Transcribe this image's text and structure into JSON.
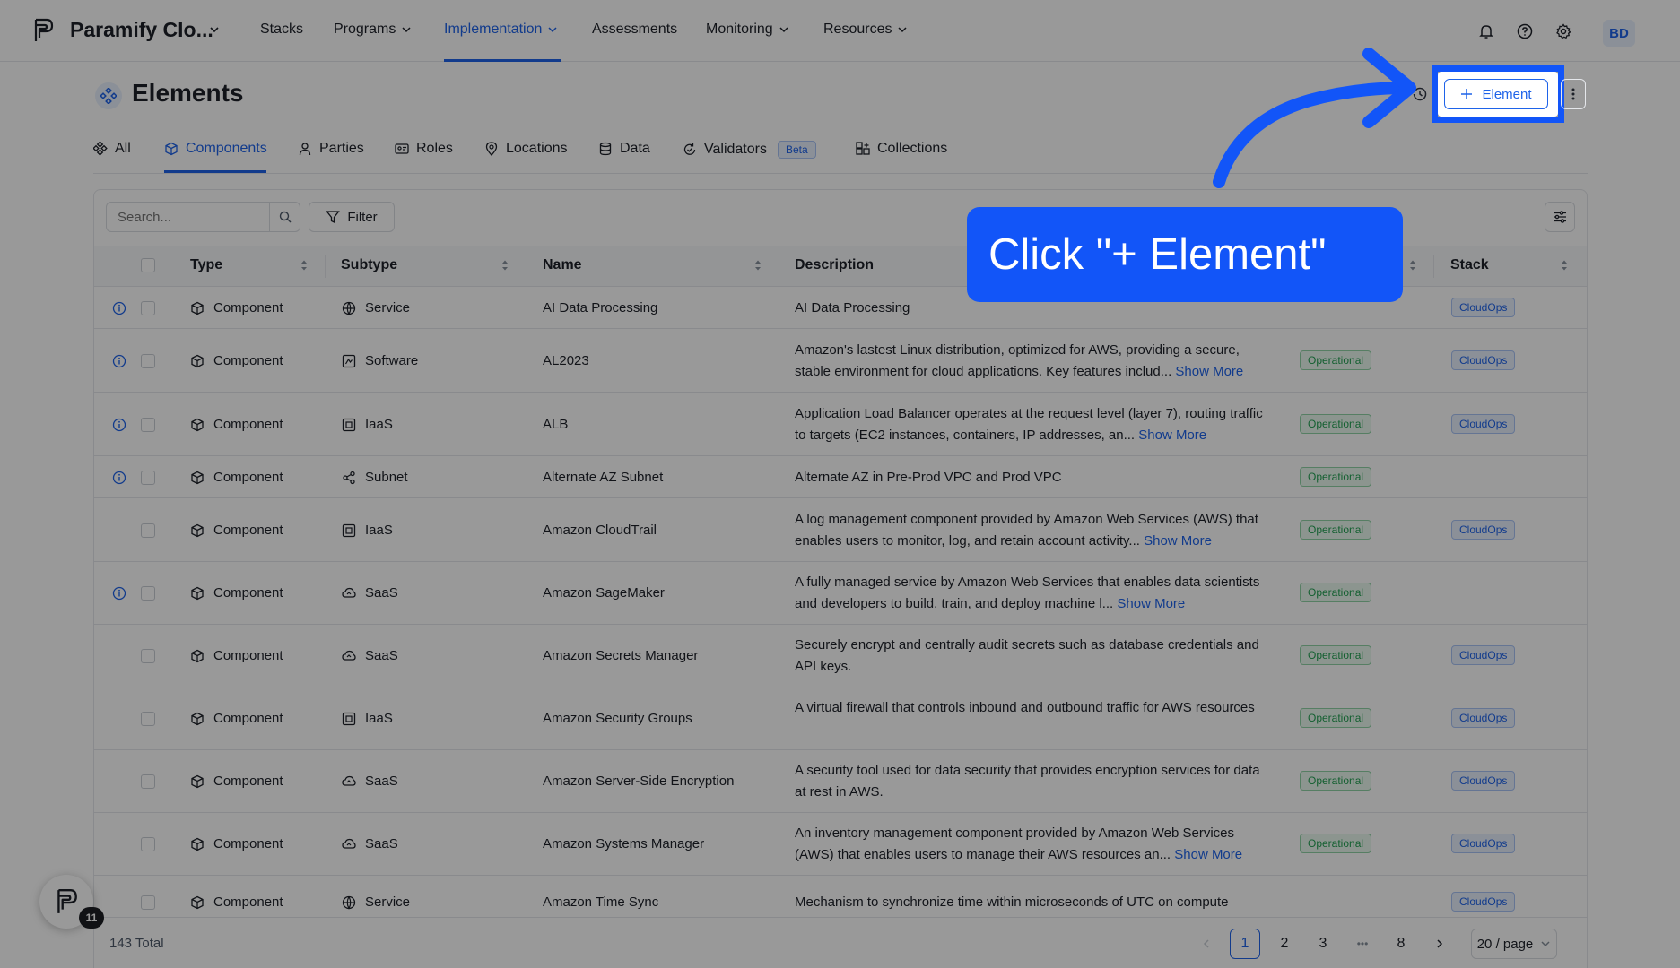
{
  "app": {
    "title": "Paramify Clo...",
    "avatar": "BD"
  },
  "nav": {
    "items": [
      {
        "label": "Stacks"
      },
      {
        "label": "Programs"
      },
      {
        "label": "Implementation"
      },
      {
        "label": "Assessments"
      },
      {
        "label": "Monitoring"
      },
      {
        "label": "Resources"
      }
    ]
  },
  "page": {
    "title": "Elements",
    "add_button": "Element"
  },
  "tabs": [
    {
      "label": "All"
    },
    {
      "label": "Components"
    },
    {
      "label": "Parties"
    },
    {
      "label": "Roles"
    },
    {
      "label": "Locations"
    },
    {
      "label": "Data"
    },
    {
      "label": "Validators",
      "badge": "Beta"
    },
    {
      "label": "Collections"
    }
  ],
  "toolbar": {
    "search_placeholder": "Search...",
    "filter_label": "Filter"
  },
  "table": {
    "headers": {
      "type": "Type",
      "subtype": "Subtype",
      "name": "Name",
      "description": "Description",
      "stack": "Stack"
    },
    "show_more": "Show More",
    "rows": [
      {
        "type": "Component",
        "subtype": "Service",
        "name": "AI Data Processing",
        "desc": "AI Data Processing",
        "status": "",
        "stack": "CloudOps",
        "info": true
      },
      {
        "type": "Component",
        "subtype": "Software",
        "name": "AL2023",
        "desc": "Amazon's lastest Linux distribution, optimized for AWS, providing a secure, stable environment for cloud applications. Key features includ...",
        "status": "Operational",
        "stack": "CloudOps",
        "info": true,
        "more": true
      },
      {
        "type": "Component",
        "subtype": "IaaS",
        "name": "ALB",
        "desc": "Application Load Balancer operates at the request level (layer 7), routing traffic to targets (EC2 instances, containers, IP addresses, an...",
        "status": "Operational",
        "stack": "CloudOps",
        "info": true,
        "more": true
      },
      {
        "type": "Component",
        "subtype": "Subnet",
        "name": "Alternate AZ Subnet",
        "desc": "Alternate AZ in Pre-Prod VPC and Prod VPC",
        "status": "Operational",
        "stack": "",
        "info": true
      },
      {
        "type": "Component",
        "subtype": "IaaS",
        "name": "Amazon CloudTrail",
        "desc": "A log management component provided by Amazon Web Services (AWS) that enables users to monitor, log, and retain account activity...",
        "status": "Operational",
        "stack": "CloudOps",
        "info": false,
        "more": true
      },
      {
        "type": "Component",
        "subtype": "SaaS",
        "name": "Amazon SageMaker",
        "desc": "A fully managed service by Amazon Web Services that enables data scientists and developers to build, train, and deploy machine l...",
        "status": "Operational",
        "stack": "",
        "info": true,
        "more": true
      },
      {
        "type": "Component",
        "subtype": "SaaS",
        "name": "Amazon Secrets Manager",
        "desc": "Securely encrypt and centrally audit secrets such as database credentials and API keys.",
        "status": "Operational",
        "stack": "CloudOps",
        "info": false
      },
      {
        "type": "Component",
        "subtype": "IaaS",
        "name": "Amazon Security Groups",
        "desc": "A virtual firewall that controls inbound and outbound traffic for AWS resources",
        "status": "Operational",
        "stack": "CloudOps",
        "info": false
      },
      {
        "type": "Component",
        "subtype": "SaaS",
        "name": "Amazon Server-Side Encryption",
        "desc": "A security tool used for data security that provides encryption services for data at rest in AWS.",
        "status": "Operational",
        "stack": "CloudOps",
        "info": false
      },
      {
        "type": "Component",
        "subtype": "SaaS",
        "name": "Amazon Systems Manager",
        "desc": "An inventory management component provided by Amazon Web Services (AWS) that enables users to manage their AWS resources an...",
        "status": "Operational",
        "stack": "CloudOps",
        "info": false,
        "more": true
      },
      {
        "type": "Component",
        "subtype": "Service",
        "name": "Amazon Time Sync",
        "desc": "Mechanism to synchronize time within microseconds of UTC on compute",
        "status": "",
        "stack": "CloudOps",
        "info": false
      }
    ]
  },
  "footer": {
    "total": "143 Total",
    "pages": [
      "1",
      "2",
      "3",
      "8"
    ],
    "ellipsis": "•••",
    "page_size": "20 / page"
  },
  "help": {
    "count": "11"
  },
  "callout": {
    "text": "Click \"+ Element\""
  },
  "colors": {
    "accent": "#1e63e9",
    "callout": "#1255f8",
    "operational": "#22a052"
  }
}
